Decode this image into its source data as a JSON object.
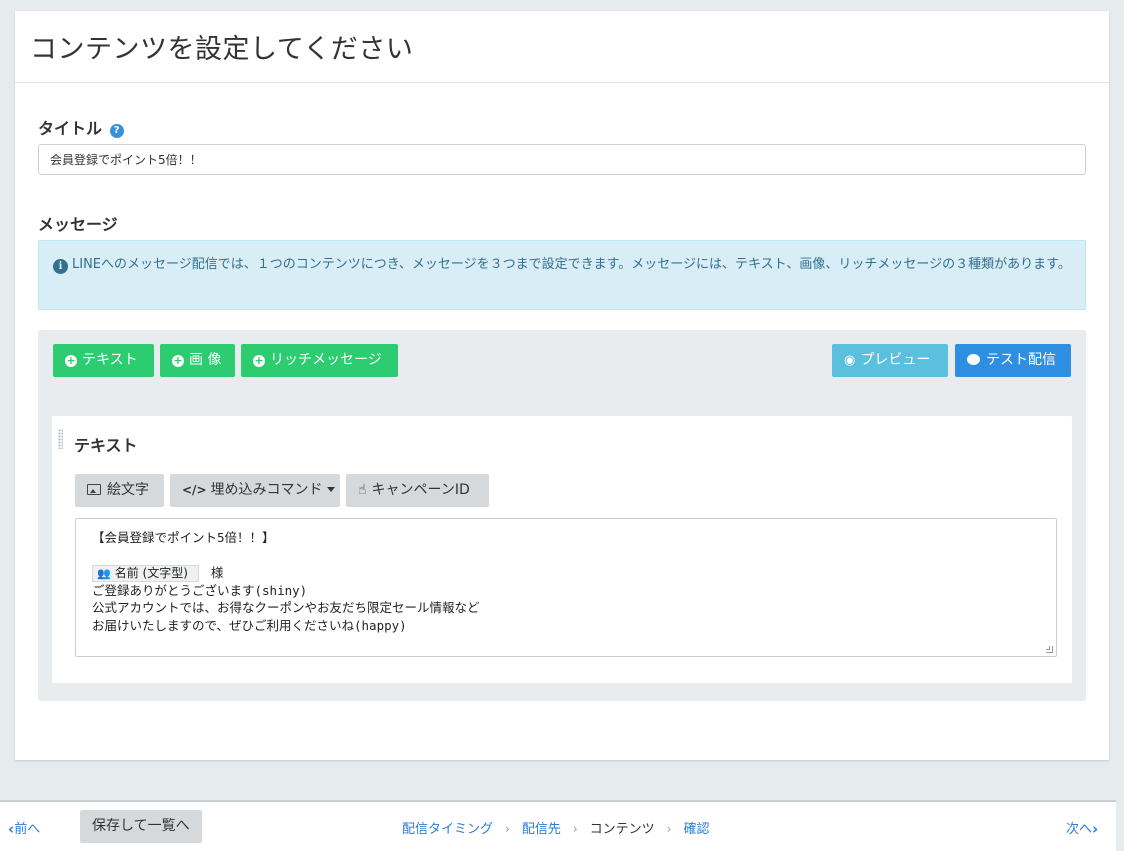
{
  "page": {
    "title": "コンテンツを設定してください"
  },
  "title_section": {
    "label": "タイトル",
    "help_glyph": "?",
    "input_value": "会員登録でポイント5倍！！"
  },
  "message_section": {
    "label": "メッセージ",
    "info_glyph": "i",
    "info_text": "LINEへのメッセージ配信では、１つのコンテンツにつき、メッセージを３つまで設定できます。メッセージには、テキスト、画像、リッチメッセージの３種類があります。"
  },
  "add_buttons": {
    "text": "テキスト",
    "image": "画 像",
    "rich": "リッチメッセージ"
  },
  "action_buttons": {
    "preview": "プレビュー",
    "test_send": "テスト配信"
  },
  "text_card": {
    "title": "テキスト",
    "tools": {
      "emoji": "絵文字",
      "embed": "埋め込みコマンド",
      "campaign": "キャンペーンID"
    },
    "lines": [
      "【会員登録でポイント5倍！！】",
      "",
      "ご登録ありがとうございます(shiny)",
      "公式アカウントでは、お得なクーポンやお友だち限定セール情報など",
      "お届けいたしますので、ぜひご利用くださいね(happy)"
    ],
    "name_tag": "名前 (文字型)",
    "name_suffix": "様"
  },
  "footer": {
    "prev": "前へ",
    "save": "保存して一覧へ",
    "steps": [
      "配信タイミング",
      "配信先",
      "コンテンツ",
      "確認"
    ],
    "current_step": "コンテンツ",
    "next": "次へ"
  },
  "colors": {
    "green": "#2ecc71",
    "light_blue": "#5bc0de",
    "blue": "#2e8fe0",
    "info_bg": "#d9edf7",
    "link": "#2e7bd0"
  }
}
